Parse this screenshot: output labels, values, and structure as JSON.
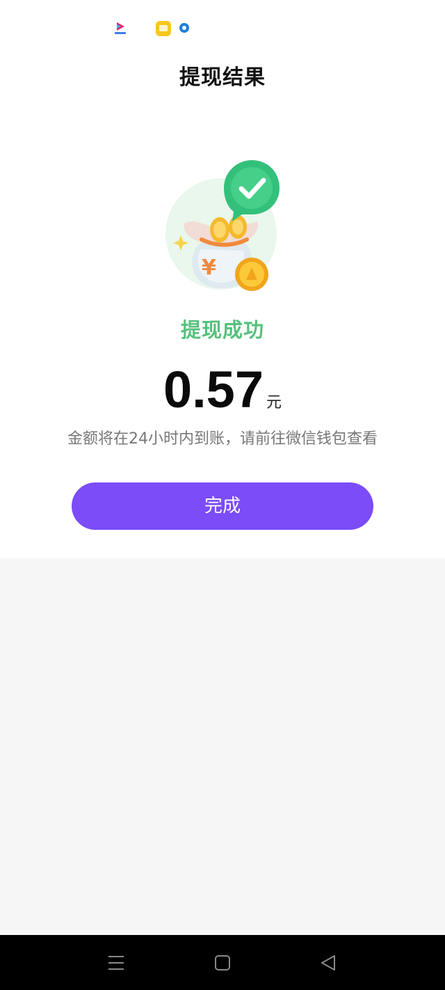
{
  "header": {
    "title": "提现结果"
  },
  "status_bar": {
    "icons": [
      "youku-icon",
      "notes-icon",
      "circle-notification-icon"
    ]
  },
  "result": {
    "illustration": "money-bag-success-icon",
    "status": "提现成功",
    "amount": "0.57",
    "unit": "元",
    "notice": "金额将在24小时内到账，请前往微信钱包查看"
  },
  "actions": {
    "done_label": "完成"
  },
  "nav_bar": {
    "buttons": [
      "menu-icon",
      "home-icon",
      "back-icon"
    ]
  },
  "colors": {
    "accent": "#7b4cf7",
    "success": "#56c07c",
    "background": "#f6f6f6",
    "card": "#ffffff",
    "nav": "#000000"
  }
}
